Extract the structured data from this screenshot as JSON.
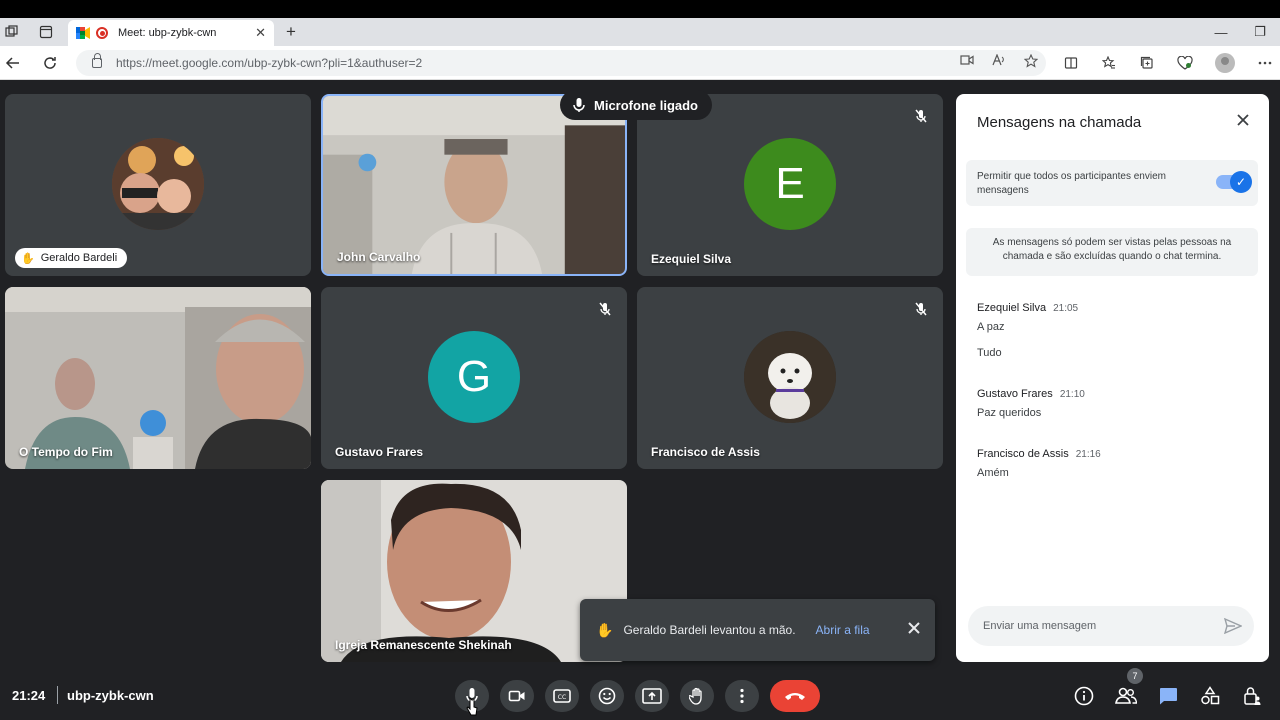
{
  "browser": {
    "tab_title": "Meet: ubp-zybk-cwn",
    "tab_close": "✕",
    "new_tab": "+",
    "url": "https://meet.google.com/ubp-zybk-cwn?pli=1&authuser=2",
    "minimize": "—",
    "maximize": "❐"
  },
  "tiles": [
    {
      "name": "Geraldo Bardeli"
    },
    {
      "name": "John Carvalho"
    },
    {
      "name": "Ezequiel Silva",
      "initial": "E"
    },
    {
      "name": "O Tempo do Fim"
    },
    {
      "name": "Gustavo Frares",
      "initial": "G"
    },
    {
      "name": "Francisco de Assis"
    },
    {
      "name": "Igreja Remanescente Shekinah"
    }
  ],
  "mic_banner": "Microfone ligado",
  "chat": {
    "title": "Mensagens na chamada",
    "permission_text": "Permitir que todos os participantes enviem mensagens",
    "info_text": "As mensagens só podem ser vistas pelas pessoas na chamada e são excluídas quando o chat termina.",
    "messages": [
      {
        "sender": "Ezequiel Silva",
        "time": "21:05",
        "lines": [
          "A paz",
          "Tudo"
        ]
      },
      {
        "sender": "Gustavo Frares",
        "time": "21:10",
        "lines": [
          "Paz queridos"
        ]
      },
      {
        "sender": "Francisco de Assis",
        "time": "21:16",
        "lines": [
          "Amém"
        ]
      }
    ],
    "input_placeholder": "Enviar uma mensagem"
  },
  "toast": {
    "text": "Geraldo Bardeli levantou a mão.",
    "link": "Abrir a fila"
  },
  "bottom": {
    "time": "21:24",
    "meeting_code": "ubp-zybk-cwn",
    "participants_count": "7"
  },
  "colors": {
    "background": "#202124",
    "tile": "#3c4043",
    "avatar_e": "#3d8b1d",
    "avatar_g": "#12a4a4",
    "hangup": "#ea4335",
    "accent": "#8ab4f8"
  }
}
